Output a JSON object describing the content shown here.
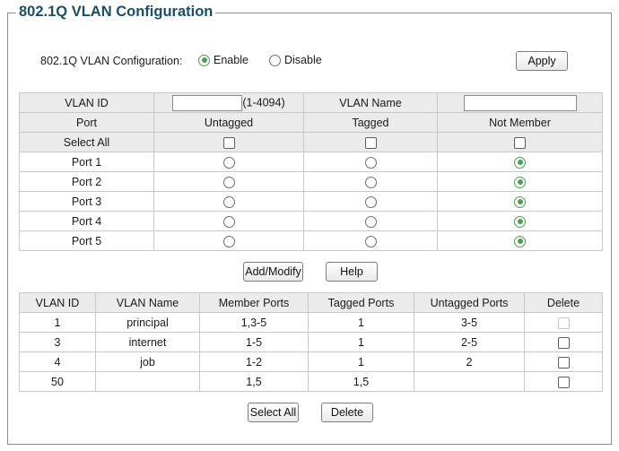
{
  "title": "802.1Q VLAN Configuration",
  "config": {
    "label": "802.1Q VLAN Configuration:",
    "enable_label": "Enable",
    "disable_label": "Disable",
    "selected": "enable",
    "apply_label": "Apply"
  },
  "form": {
    "vlan_id_label": "VLAN ID",
    "vlan_id_value": "",
    "vlan_id_range": "(1-4094)",
    "vlan_name_label": "VLAN Name",
    "vlan_name_value": "",
    "col_port": "Port",
    "col_untagged": "Untagged",
    "col_tagged": "Tagged",
    "col_not_member": "Not Member",
    "select_all_label": "Select All",
    "ports": [
      {
        "name": "Port 1",
        "selection": "not_member"
      },
      {
        "name": "Port 2",
        "selection": "not_member"
      },
      {
        "name": "Port 3",
        "selection": "not_member"
      },
      {
        "name": "Port 4",
        "selection": "not_member"
      },
      {
        "name": "Port 5",
        "selection": "not_member"
      }
    ],
    "add_modify_label": "Add/Modify",
    "help_label": "Help"
  },
  "list": {
    "headers": [
      "VLAN ID",
      "VLAN Name",
      "Member Ports",
      "Tagged Ports",
      "Untagged Ports",
      "Delete"
    ],
    "rows": [
      {
        "vlan_id": "1",
        "name": "principal",
        "member": "1,3-5",
        "tagged": "1",
        "untagged": "3-5",
        "delete_disabled": true
      },
      {
        "vlan_id": "3",
        "name": "internet",
        "member": "1-5",
        "tagged": "1",
        "untagged": "2-5",
        "delete_disabled": false
      },
      {
        "vlan_id": "4",
        "name": "job",
        "member": "1-2",
        "tagged": "1",
        "untagged": "2",
        "delete_disabled": false
      },
      {
        "vlan_id": "50",
        "name": "",
        "member": "1,5",
        "tagged": "1,5",
        "untagged": "",
        "delete_disabled": false
      }
    ],
    "select_all_label": "Select All",
    "delete_label": "Delete"
  },
  "colors": {
    "accent": "#1b4f66",
    "radio_selected": "#4e9e57",
    "header_bg": "#ebebeb"
  }
}
